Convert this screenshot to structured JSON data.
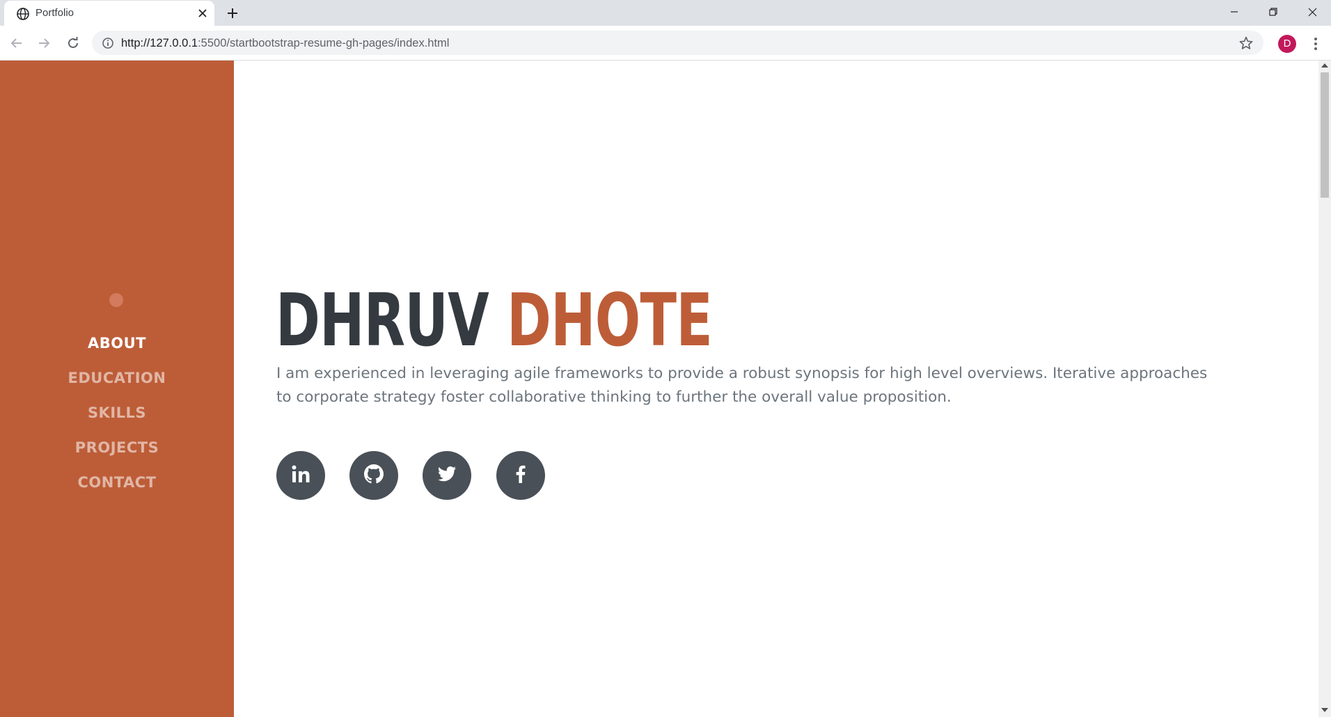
{
  "browser": {
    "tab_title": "Portfolio",
    "url_host": "http://127.0.0.1",
    "url_rest": ":5500/startbootstrap-resume-gh-pages/index.html",
    "profile_initial": "D",
    "profile_color": "#c2185b"
  },
  "sidebar": {
    "color": "#bd5d38",
    "items": [
      {
        "label": "ABOUT",
        "active": true
      },
      {
        "label": "EDUCATION",
        "active": false
      },
      {
        "label": "SKILLS",
        "active": false
      },
      {
        "label": "PROJECTS",
        "active": false
      },
      {
        "label": "CONTACT",
        "active": false
      }
    ]
  },
  "hero": {
    "first_name": "DHRUV",
    "last_name": "DHOTE",
    "first_name_color": "#343a40",
    "last_name_color": "#bd5d38",
    "lead": "I am experienced in leveraging agile frameworks to provide a robust synopsis for high level overviews. Iterative approaches to corporate strategy foster collaborative thinking to further the overall value proposition."
  },
  "social": [
    {
      "icon": "linkedin-icon"
    },
    {
      "icon": "github-icon"
    },
    {
      "icon": "twitter-icon"
    },
    {
      "icon": "facebook-icon"
    }
  ]
}
